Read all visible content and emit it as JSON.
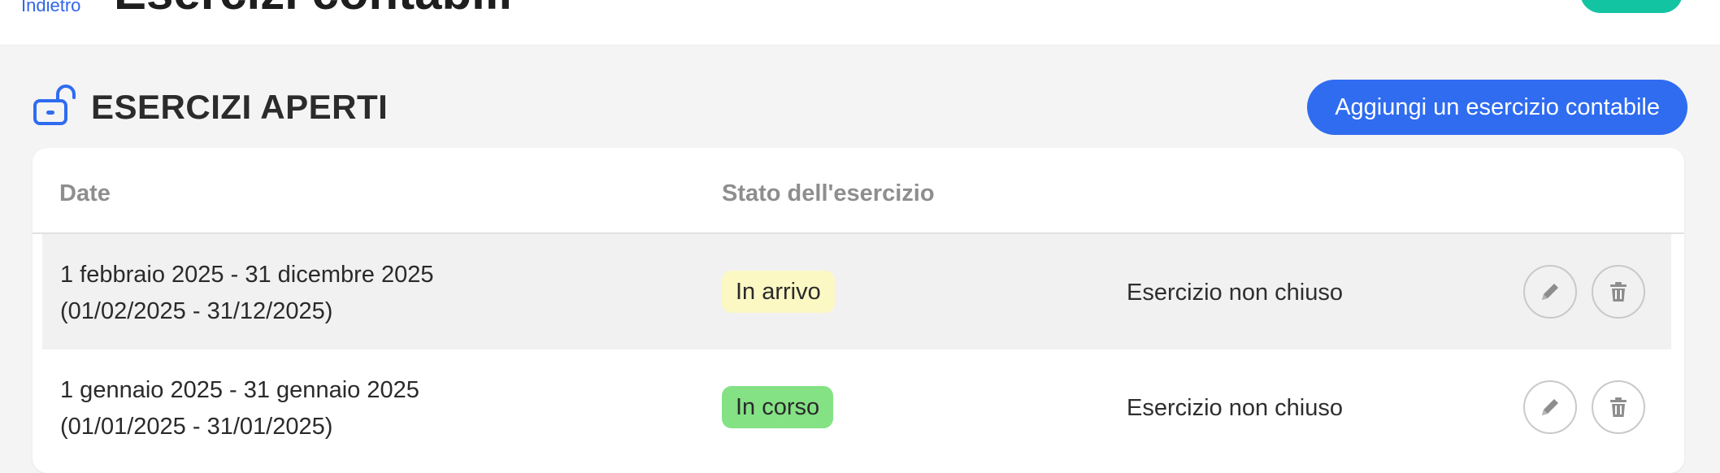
{
  "header": {
    "back_label": "Indietro",
    "title": "Esercizi contabili"
  },
  "section": {
    "title": "ESERCIZI APERTI",
    "add_button": "Aggiungi un esercizio contabile",
    "icon": "unlocked-padlock-icon"
  },
  "table": {
    "columns": [
      "Date",
      "Stato dell'esercizio"
    ],
    "rows": [
      {
        "date_long": "1 febbraio 2025 - 31 dicembre 2025",
        "date_short": "(01/02/2025 - 31/12/2025)",
        "status": "In arrivo",
        "closure": "Esercizio non chiuso"
      },
      {
        "date_long": "1 gennaio 2025 - 31 gennaio 2025",
        "date_short": "(01/01/2025 - 31/01/2025)",
        "status": "In corso",
        "closure": "Esercizio non chiuso"
      }
    ],
    "row_actions": [
      "pencil-icon",
      "trash-icon"
    ]
  },
  "colors": {
    "accent_blue": "#2f6cf0",
    "top_action_teal": "#13c4a3",
    "badge_incoming": "#fcf8c4",
    "badge_ongoing": "#84e285"
  }
}
